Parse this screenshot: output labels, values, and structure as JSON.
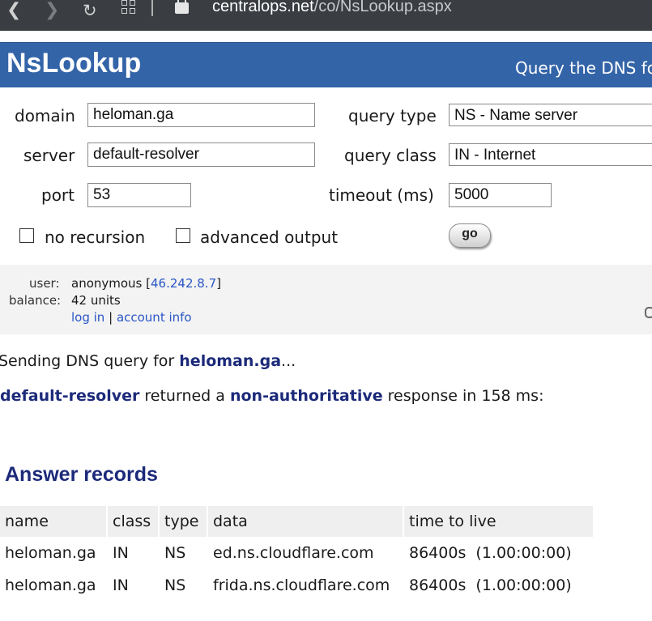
{
  "browser": {
    "url_host": "centralops.net",
    "url_path": "/co/NsLookup.aspx",
    "icons": [
      "back-icon",
      "forward-icon",
      "reload-icon",
      "tabs-grid-icon",
      "lock-icon"
    ]
  },
  "header": {
    "title": "NsLookup",
    "tagline": "Query the DNS fo",
    "bg_color": "#3464a8"
  },
  "form": {
    "domain_label": "domain",
    "domain_value": "heloman.ga",
    "server_label": "server",
    "server_value": "default-resolver",
    "port_label": "port",
    "port_value": "53",
    "query_type_label": "query type",
    "query_type_value": "NS - Name server",
    "query_class_label": "query class",
    "query_class_value": "IN - Internet",
    "timeout_label": "timeout (ms)",
    "timeout_value": "5000",
    "no_recursion_label": "no recursion",
    "advanced_output_label": "advanced output",
    "go_label": "go"
  },
  "user": {
    "user_label": "user:",
    "user_name": "anonymous",
    "user_ip": "46.242.8.7",
    "balance_label": "balance:",
    "balance_value": "42 units",
    "login_link": "log in",
    "separator": "|",
    "account_link": "account info"
  },
  "results": {
    "sending_prefix": "Sending DNS query for ",
    "sending_domain": "heloman.ga",
    "sending_suffix": "...",
    "resolver": "default-resolver",
    "returned_text": " returned a ",
    "response_kind": "non-authoritative",
    "response_text": " response in 158 ms:",
    "section_title": "Answer records",
    "columns": [
      "name",
      "class",
      "type",
      "data",
      "time to live"
    ],
    "rows": [
      [
        "heloman.ga",
        "IN",
        "NS",
        "ed.ns.cloudflare.com",
        "86400s  (1.00:00:00)"
      ],
      [
        "heloman.ga",
        "IN",
        "NS",
        "frida.ns.cloudflare.com",
        "86400s  (1.00:00:00)"
      ]
    ]
  }
}
